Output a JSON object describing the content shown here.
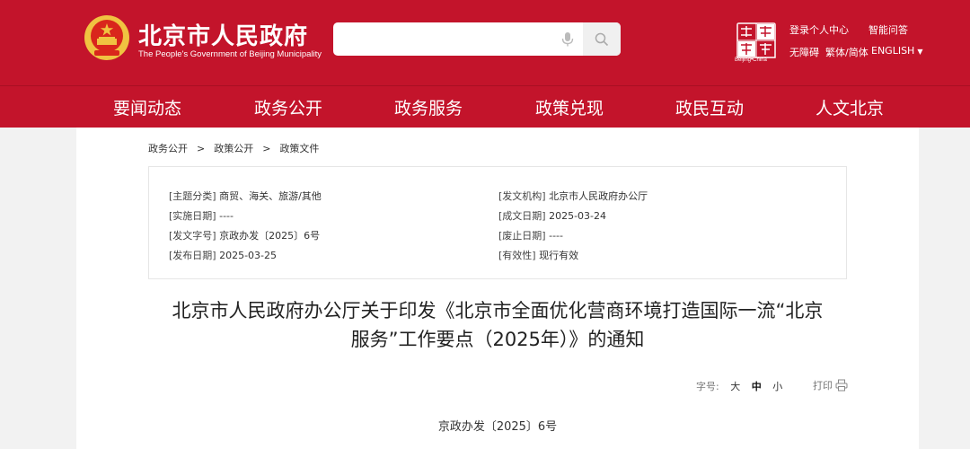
{
  "header": {
    "title": "北京市人民政府",
    "subtitle": "The People's Government of Beijing Municipality",
    "search_placeholder": "",
    "seal_caption": "Beijing•China",
    "links": {
      "login": "登录个人中心",
      "qa": "智能问答",
      "accessibility": "无障碍",
      "trad_simp": "繁体/简体",
      "english": "ENGLISH"
    },
    "colors": {
      "brand_red": "#c3142b",
      "gold": "#f0c341"
    }
  },
  "nav": {
    "items": [
      {
        "label": "要闻动态"
      },
      {
        "label": "政务公开"
      },
      {
        "label": "政务服务"
      },
      {
        "label": "政策兑现"
      },
      {
        "label": "政民互动"
      },
      {
        "label": "人文北京"
      }
    ]
  },
  "breadcrumb": [
    "政务公开",
    "政策公开",
    "政策文件"
  ],
  "breadcrumb_sep": ">",
  "meta": {
    "subject_label": "[主题分类]",
    "subject": "商贸、海关、旅游/其他",
    "issuer_label": "[发文机构]",
    "issuer": "北京市人民政府办公厅",
    "effective_label": "[实施日期]",
    "effective": "----",
    "created_label": "[成文日期]",
    "created": "2025-03-24",
    "docno_label": "[发文字号]",
    "docno": "京政办发〔2025〕6号",
    "expiry_label": "[废止日期]",
    "expiry": "----",
    "published_label": "[发布日期]",
    "published": "2025-03-25",
    "validity_label": "[有效性]",
    "validity": "现行有效"
  },
  "document": {
    "title_line1": "北京市人民政府办公厅关于印发《北京市全面优化营商环境打造国际一流“北京",
    "title_line2": "服务”工作要点（2025年）》的通知",
    "number": "京政办发〔2025〕6号"
  },
  "tools": {
    "font_label": "字号:",
    "font_large": "大",
    "font_medium": "中",
    "font_small": "小",
    "print": "打印"
  }
}
